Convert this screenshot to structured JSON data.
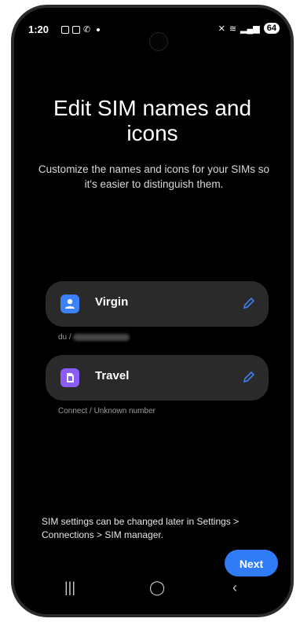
{
  "status": {
    "time": "1:20",
    "battery": "64"
  },
  "main": {
    "title": "Edit SIM names and icons",
    "description": "Customize the names and icons for your SIMs so it's easier to distinguish them."
  },
  "sims": [
    {
      "name": "Virgin",
      "subtitle": "du /",
      "color": "#3b82f6"
    },
    {
      "name": "Travel",
      "subtitle": "Connect / Unknown number",
      "color": "#8b5cf6"
    }
  ],
  "footer": {
    "note": "SIM settings can be changed later in Settings > Connections > SIM manager.",
    "next_label": "Next"
  },
  "colors": {
    "accent": "#2f7cf6",
    "card": "#2a2a2a"
  }
}
